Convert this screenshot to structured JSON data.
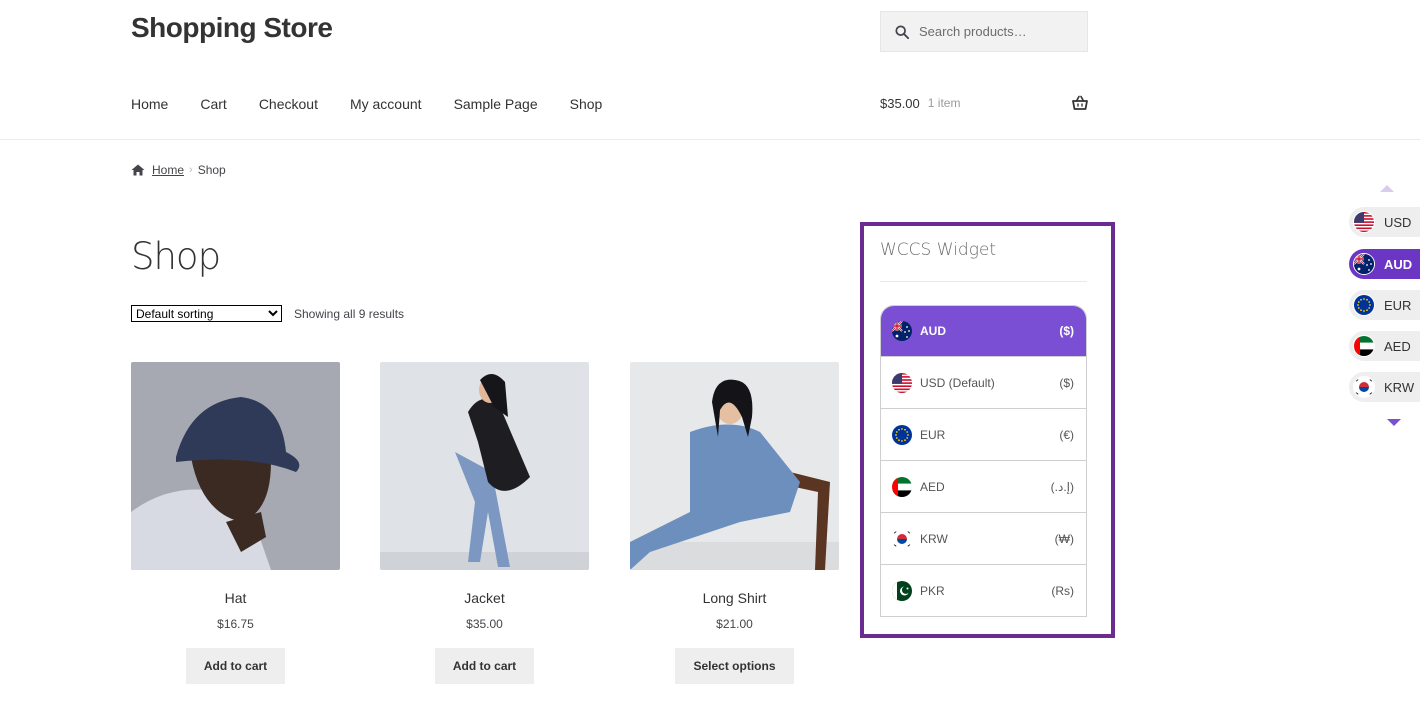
{
  "site": {
    "title": "Shopping Store"
  },
  "search": {
    "placeholder": "Search products…"
  },
  "nav": {
    "items": [
      "Home",
      "Cart",
      "Checkout",
      "My account",
      "Sample Page",
      "Shop"
    ]
  },
  "cart": {
    "amount": "$35.00",
    "count": "1 item"
  },
  "breadcrumb": {
    "home": "Home",
    "current": "Shop"
  },
  "page": {
    "title": "Shop"
  },
  "sorting": {
    "selected": "Default sorting",
    "result_count": "Showing all 9 results"
  },
  "products": [
    {
      "name": "Hat",
      "price": "$16.75",
      "button": "Add to cart"
    },
    {
      "name": "Jacket",
      "price": "$35.00",
      "button": "Add to cart"
    },
    {
      "name": "Long Shirt",
      "price": "$21.00",
      "button": "Select options"
    }
  ],
  "widget": {
    "title": "WCCS Widget",
    "currencies": [
      {
        "code": "AUD",
        "symbol": "($)",
        "flag": "au-flag",
        "active": true
      },
      {
        "code": "USD (Default)",
        "symbol": "($)",
        "flag": "us-flag",
        "active": false
      },
      {
        "code": "EUR",
        "symbol": "(€)",
        "flag": "eu-flag",
        "active": false
      },
      {
        "code": "AED",
        "symbol": "(.إ.د)",
        "flag": "ae-flag",
        "active": false
      },
      {
        "code": "KRW",
        "symbol": "(₩)",
        "flag": "kr-flag",
        "active": false
      },
      {
        "code": "PKR",
        "symbol": "(Rs)",
        "flag": "pk-flag",
        "active": false
      }
    ]
  },
  "side_switcher": {
    "items": [
      {
        "code": "USD",
        "flag": "us-flag",
        "active": false
      },
      {
        "code": "AUD",
        "flag": "au-flag",
        "active": true
      },
      {
        "code": "EUR",
        "flag": "eu-flag",
        "active": false
      },
      {
        "code": "AED",
        "flag": "ae-flag",
        "active": false
      },
      {
        "code": "KRW",
        "flag": "kr-flag",
        "active": false
      }
    ]
  },
  "colors": {
    "accent": "#7b4fd3",
    "frame": "#6a2c91",
    "button_bg": "#eeeeee"
  }
}
